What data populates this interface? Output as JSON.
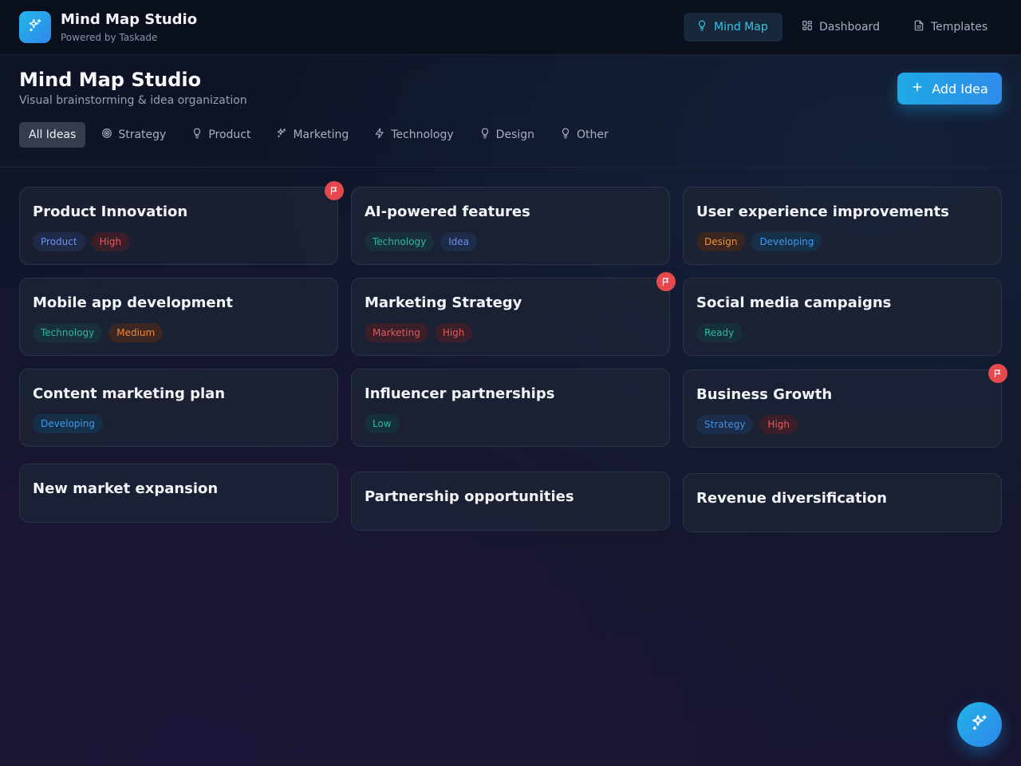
{
  "header": {
    "app_title": "Mind Map Studio",
    "app_subtitle": "Powered by Taskade",
    "nav": [
      {
        "label": "Mind Map",
        "icon": "lightbulb-icon",
        "active": true
      },
      {
        "label": "Dashboard",
        "icon": "grid-icon",
        "active": false
      },
      {
        "label": "Templates",
        "icon": "document-icon",
        "active": false
      }
    ]
  },
  "main": {
    "title": "Mind Map Studio",
    "subtitle": "Visual brainstorming & idea organization",
    "add_button_label": "Add Idea",
    "filters": [
      {
        "label": "All Ideas",
        "icon": "",
        "active": true
      },
      {
        "label": "Strategy",
        "icon": "target-icon",
        "active": false
      },
      {
        "label": "Product",
        "icon": "lightbulb-icon",
        "active": false
      },
      {
        "label": "Marketing",
        "icon": "sparkles-icon",
        "active": false
      },
      {
        "label": "Technology",
        "icon": "lightning-icon",
        "active": false
      },
      {
        "label": "Design",
        "icon": "lightbulb-icon",
        "active": false
      },
      {
        "label": "Other",
        "icon": "lightbulb-icon",
        "active": false
      }
    ],
    "ideas": [
      {
        "title": "Product Innovation",
        "tags": [
          {
            "label": "Product",
            "kind": "product"
          },
          {
            "label": "High",
            "kind": "high"
          }
        ],
        "flagged": true
      },
      {
        "title": "AI-powered features",
        "tags": [
          {
            "label": "Technology",
            "kind": "technology"
          },
          {
            "label": "Idea",
            "kind": "idea"
          }
        ],
        "flagged": false
      },
      {
        "title": "User experience improvements",
        "tags": [
          {
            "label": "Design",
            "kind": "design"
          },
          {
            "label": "Developing",
            "kind": "developing"
          }
        ],
        "flagged": false
      },
      {
        "title": "Mobile app development",
        "tags": [
          {
            "label": "Technology",
            "kind": "technology"
          },
          {
            "label": "Medium",
            "kind": "medium"
          }
        ],
        "flagged": false
      },
      {
        "title": "Marketing Strategy",
        "tags": [
          {
            "label": "Marketing",
            "kind": "marketing"
          },
          {
            "label": "High",
            "kind": "high"
          }
        ],
        "flagged": true
      },
      {
        "title": "Social media campaigns",
        "tags": [
          {
            "label": "Ready",
            "kind": "ready"
          }
        ],
        "flagged": false
      },
      {
        "title": "Content marketing plan",
        "tags": [
          {
            "label": "Developing",
            "kind": "developing"
          }
        ],
        "flagged": false
      },
      {
        "title": "Influencer partnerships",
        "tags": [
          {
            "label": "Low",
            "kind": "low"
          }
        ],
        "flagged": false
      },
      {
        "title": "Business Growth",
        "tags": [
          {
            "label": "Strategy",
            "kind": "strategy"
          },
          {
            "label": "High",
            "kind": "high"
          }
        ],
        "flagged": true
      },
      {
        "title": "New market expansion",
        "tags": [],
        "flagged": false
      },
      {
        "title": "Partnership opportunities",
        "tags": [],
        "flagged": false
      },
      {
        "title": "Revenue diversification",
        "tags": [],
        "flagged": false
      }
    ]
  },
  "colors": {
    "accent": "#2b9fe6",
    "flag": "#e5484d",
    "tag_kinds": {
      "product": {
        "bg": "#1f2a4a",
        "fg": "#6f92f0"
      },
      "high": {
        "bg": "#3a1f2a",
        "fg": "#e25b5b"
      },
      "technology": {
        "bg": "#17303a",
        "fg": "#2fb5a3"
      },
      "idea": {
        "bg": "#1e2b4b",
        "fg": "#6b8fea"
      },
      "design": {
        "bg": "#3a2620",
        "fg": "#f0903c"
      },
      "developing": {
        "bg": "#17304a",
        "fg": "#3e9bec"
      },
      "medium": {
        "bg": "#3a2622",
        "fg": "#f08a3c"
      },
      "marketing": {
        "bg": "#3a1f28",
        "fg": "#e25b5b"
      },
      "ready": {
        "bg": "#15303a",
        "fg": "#2fb5a3"
      },
      "low": {
        "bg": "#15303a",
        "fg": "#2fb5a3"
      },
      "strategy": {
        "bg": "#1b2d4a",
        "fg": "#3e8fe0"
      }
    }
  }
}
